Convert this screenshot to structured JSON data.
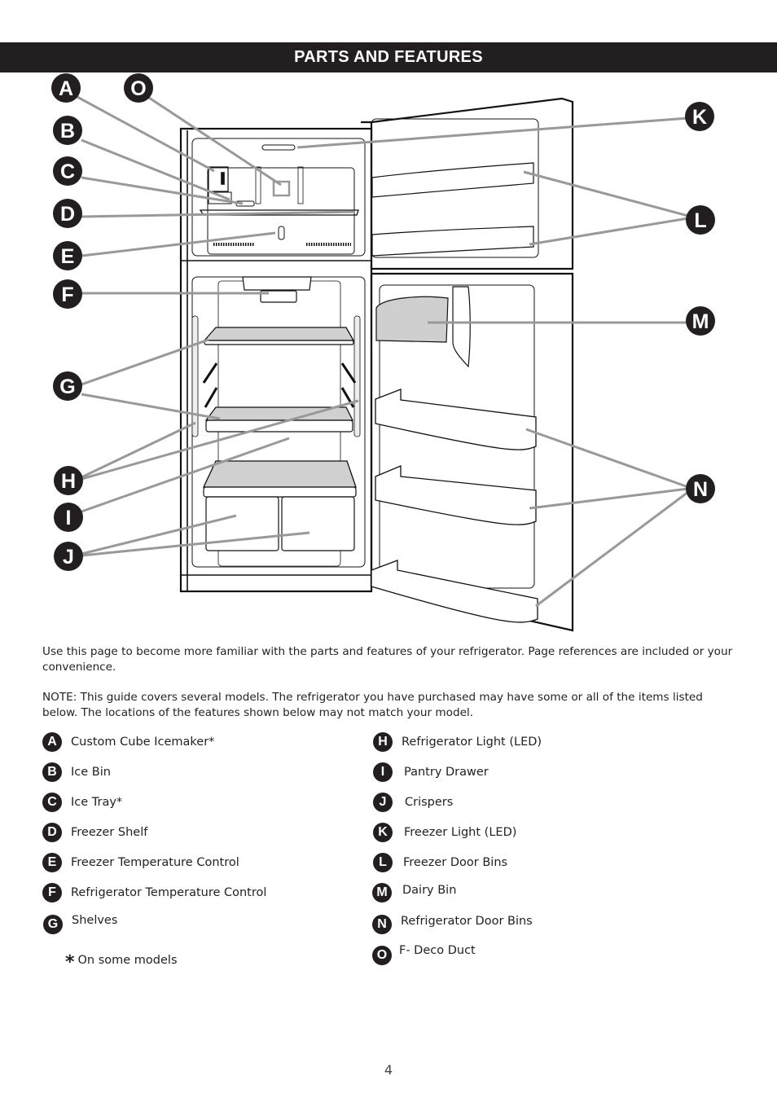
{
  "header": {
    "title": "PARTS AND FEATURES"
  },
  "colors": {
    "header_bg": "#231f20",
    "badge_bg": "#231f20",
    "leader_line": "#999999",
    "shelf_fill": "#cfcfcf"
  },
  "diagram": {
    "callouts": [
      "A",
      "B",
      "C",
      "D",
      "E",
      "F",
      "G",
      "H",
      "I",
      "J",
      "K",
      "L",
      "M",
      "N",
      "O"
    ]
  },
  "intro": {
    "paragraph1": "Use this page to become more familiar with the parts and features of your refrigerator. Page references are included or your convenience.",
    "paragraph2": "NOTE: This guide covers several models. The refrigerator you have purchased may have some or all of the items listed below. The locations of the features shown below may not match your model."
  },
  "legend": {
    "left": [
      {
        "letter": "A",
        "label": "Custom Cube Icemaker*"
      },
      {
        "letter": "B",
        "label": "Ice Bin"
      },
      {
        "letter": "C",
        "label": "Ice Tray*"
      },
      {
        "letter": "D",
        "label": "Freezer Shelf"
      },
      {
        "letter": "E",
        "label": "Freezer Temperature Control"
      },
      {
        "letter": "F",
        "label": "Refrigerator Temperature Control"
      },
      {
        "letter": "G",
        "label": "Shelves"
      }
    ],
    "right": [
      {
        "letter": "H",
        "label": "Refrigerator Light (LED)"
      },
      {
        "letter": "I",
        "label": "Pantry Drawer"
      },
      {
        "letter": "J",
        "label": "Crispers"
      },
      {
        "letter": "K",
        "label": "Freezer Light (LED)"
      },
      {
        "letter": "L",
        "label": "Freezer Door Bins"
      },
      {
        "letter": "M",
        "label": "Dairy Bin"
      },
      {
        "letter": "N",
        "label": "Refrigerator Door Bins"
      },
      {
        "letter": "O",
        "label": "F- Deco Duct"
      }
    ],
    "footnote_symbol": "*",
    "footnote_text": "On some models"
  },
  "page_number": "4"
}
